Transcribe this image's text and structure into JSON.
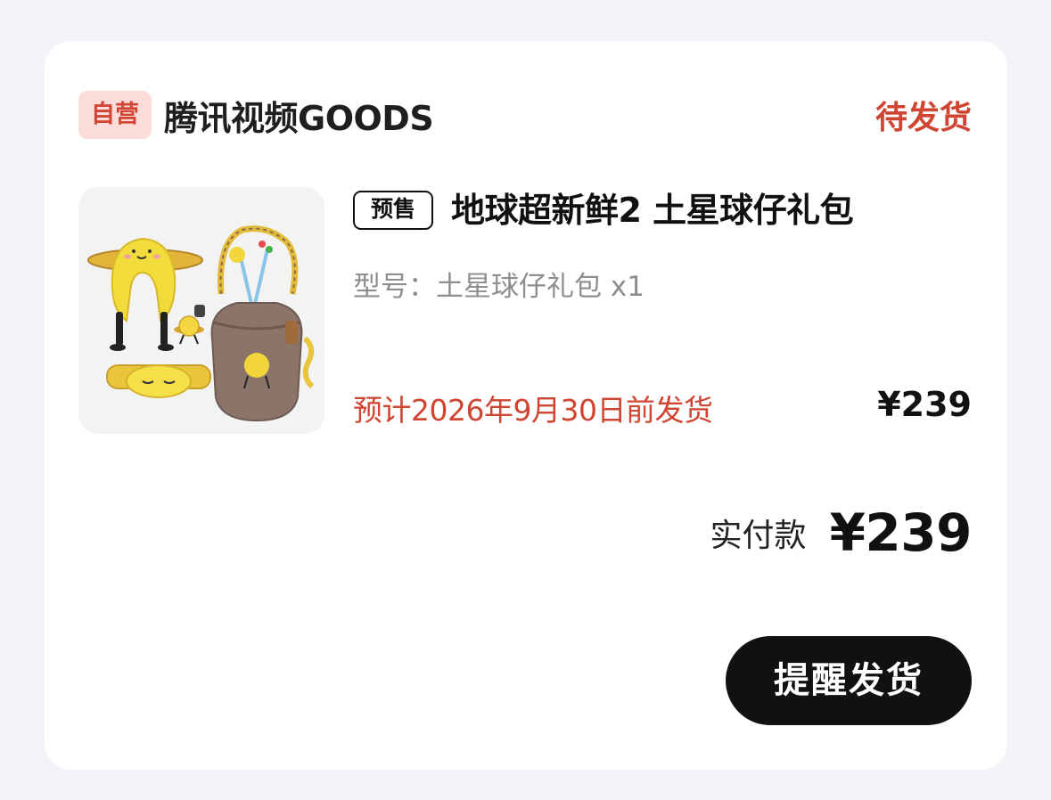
{
  "store": {
    "badge": "自营",
    "name": "腾讯视频GOODS",
    "status": "待发货"
  },
  "product": {
    "image_icon": "product-image",
    "presale_tag": "预售",
    "title": "地球超新鲜2 土星球仔礼包",
    "spec": "型号：土星球仔礼包 x1",
    "ship_estimate": "预计2026年9月30日前发货",
    "price": "¥239"
  },
  "summary": {
    "total_label": "实付款",
    "total_amount": "¥239"
  },
  "actions": {
    "remind_label": "提醒发货"
  },
  "colors": {
    "accent_red": "#d04532",
    "badge_bg": "#fbdcd8",
    "button_bg": "#111111",
    "page_bg": "#f3f3f8"
  }
}
